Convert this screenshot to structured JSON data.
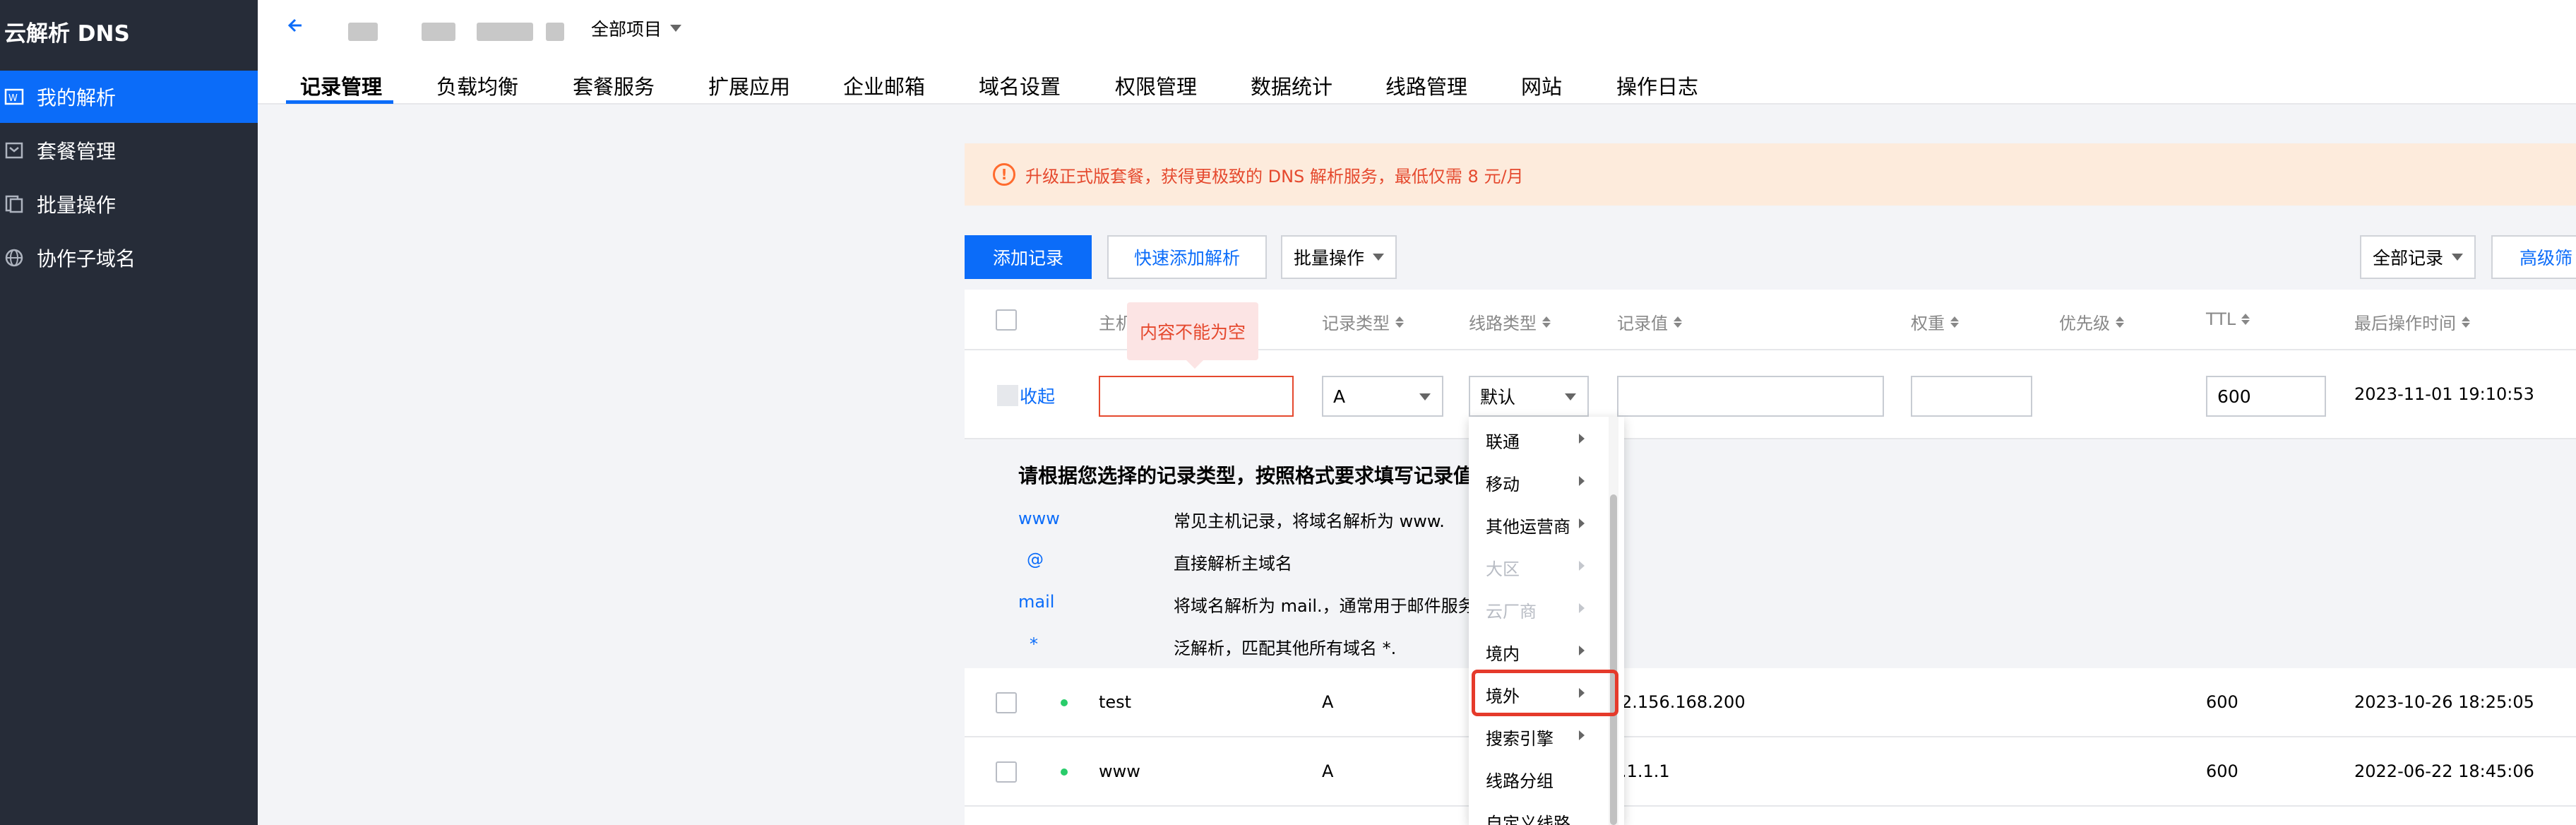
{
  "sidebar": {
    "brand": "云解析 DNS",
    "items": [
      {
        "label": "我的解析",
        "icon": "parse-icon"
      },
      {
        "label": "套餐管理",
        "icon": "package-icon"
      },
      {
        "label": "批量操作",
        "icon": "batch-icon"
      },
      {
        "label": "协作子域名",
        "icon": "globe-icon"
      }
    ]
  },
  "header": {
    "project_selector": "全部项目",
    "tabs": [
      "记录管理",
      "负载均衡",
      "套餐服务",
      "扩展应用",
      "企业邮箱",
      "域名设置",
      "权限管理",
      "数据统计",
      "线路管理",
      "网站",
      "操作日志"
    ]
  },
  "notice": {
    "text": "升级正式版套餐，获得更极致的 DNS 解析服务，最低仅需 8 元/月"
  },
  "toolbar": {
    "add_record": "添加记录",
    "quick_add": "快速添加解析",
    "batch": "批量操作",
    "filter_all": "全部记录",
    "advanced_filter": "高级筛"
  },
  "table": {
    "headers": [
      "主机",
      "记录类型",
      "线路类型",
      "记录值",
      "权重",
      "优先级",
      "TTL",
      "最后操作时间"
    ],
    "edit_row": {
      "collapse": "收起",
      "error_tip": "内容不能为空",
      "record_type": "A",
      "line_type": "默认",
      "ttl": "600",
      "time": "2023-11-01 19:10:53"
    },
    "guide": {
      "title": "请根据您选择的记录类型，按照格式要求填写记录值",
      "items": [
        {
          "key": "www",
          "desc": "常见主机记录，将域名解析为 www."
        },
        {
          "key": "@",
          "desc": "直接解析主域名"
        },
        {
          "key": "mail",
          "desc": "将域名解析为 mail.，通常用于邮件服务"
        },
        {
          "key": "*",
          "desc": "泛解析，匹配其他所有域名 *."
        }
      ]
    },
    "rows": [
      {
        "host": "test",
        "type": "A",
        "value": "2.156.168.200",
        "ttl": "600",
        "time": "2023-10-26 18:25:05"
      },
      {
        "host": "www",
        "type": "A",
        "value": ".1.1.1",
        "ttl": "600",
        "time": "2022-06-22 18:45:06"
      }
    ]
  },
  "line_menu": {
    "items": [
      {
        "label": "联通",
        "disabled": false,
        "submenu": true
      },
      {
        "label": "移动",
        "disabled": false,
        "submenu": true
      },
      {
        "label": "其他运营商",
        "disabled": false,
        "submenu": true
      },
      {
        "label": "大区",
        "disabled": true,
        "submenu": true
      },
      {
        "label": "云厂商",
        "disabled": true,
        "submenu": true
      },
      {
        "label": "境内",
        "disabled": false,
        "submenu": true
      },
      {
        "label": "境外",
        "disabled": false,
        "submenu": true,
        "highlighted": true
      },
      {
        "label": "搜索引擎",
        "disabled": false,
        "submenu": true
      },
      {
        "label": "线路分组",
        "disabled": false,
        "submenu": false
      },
      {
        "label": "自定义线路",
        "disabled": false,
        "submenu": false
      }
    ]
  },
  "colors": {
    "accent": "#0b6cf9",
    "sidebar_bg": "#262c38",
    "error": "#e5492e",
    "notice_bg": "#fdebdc"
  }
}
